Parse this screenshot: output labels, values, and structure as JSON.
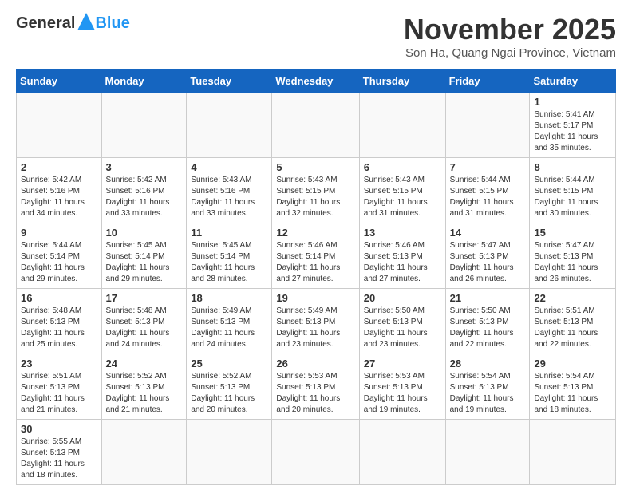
{
  "header": {
    "logo_general": "General",
    "logo_blue": "Blue",
    "month_title": "November 2025",
    "location": "Son Ha, Quang Ngai Province, Vietnam"
  },
  "weekdays": [
    "Sunday",
    "Monday",
    "Tuesday",
    "Wednesday",
    "Thursday",
    "Friday",
    "Saturday"
  ],
  "weeks": [
    [
      {
        "day": "",
        "info": ""
      },
      {
        "day": "",
        "info": ""
      },
      {
        "day": "",
        "info": ""
      },
      {
        "day": "",
        "info": ""
      },
      {
        "day": "",
        "info": ""
      },
      {
        "day": "",
        "info": ""
      },
      {
        "day": "1",
        "info": "Sunrise: 5:41 AM\nSunset: 5:17 PM\nDaylight: 11 hours and 35 minutes."
      }
    ],
    [
      {
        "day": "2",
        "info": "Sunrise: 5:42 AM\nSunset: 5:16 PM\nDaylight: 11 hours and 34 minutes."
      },
      {
        "day": "3",
        "info": "Sunrise: 5:42 AM\nSunset: 5:16 PM\nDaylight: 11 hours and 33 minutes."
      },
      {
        "day": "4",
        "info": "Sunrise: 5:43 AM\nSunset: 5:16 PM\nDaylight: 11 hours and 33 minutes."
      },
      {
        "day": "5",
        "info": "Sunrise: 5:43 AM\nSunset: 5:15 PM\nDaylight: 11 hours and 32 minutes."
      },
      {
        "day": "6",
        "info": "Sunrise: 5:43 AM\nSunset: 5:15 PM\nDaylight: 11 hours and 31 minutes."
      },
      {
        "day": "7",
        "info": "Sunrise: 5:44 AM\nSunset: 5:15 PM\nDaylight: 11 hours and 31 minutes."
      },
      {
        "day": "8",
        "info": "Sunrise: 5:44 AM\nSunset: 5:15 PM\nDaylight: 11 hours and 30 minutes."
      }
    ],
    [
      {
        "day": "9",
        "info": "Sunrise: 5:44 AM\nSunset: 5:14 PM\nDaylight: 11 hours and 29 minutes."
      },
      {
        "day": "10",
        "info": "Sunrise: 5:45 AM\nSunset: 5:14 PM\nDaylight: 11 hours and 29 minutes."
      },
      {
        "day": "11",
        "info": "Sunrise: 5:45 AM\nSunset: 5:14 PM\nDaylight: 11 hours and 28 minutes."
      },
      {
        "day": "12",
        "info": "Sunrise: 5:46 AM\nSunset: 5:14 PM\nDaylight: 11 hours and 27 minutes."
      },
      {
        "day": "13",
        "info": "Sunrise: 5:46 AM\nSunset: 5:13 PM\nDaylight: 11 hours and 27 minutes."
      },
      {
        "day": "14",
        "info": "Sunrise: 5:47 AM\nSunset: 5:13 PM\nDaylight: 11 hours and 26 minutes."
      },
      {
        "day": "15",
        "info": "Sunrise: 5:47 AM\nSunset: 5:13 PM\nDaylight: 11 hours and 26 minutes."
      }
    ],
    [
      {
        "day": "16",
        "info": "Sunrise: 5:48 AM\nSunset: 5:13 PM\nDaylight: 11 hours and 25 minutes."
      },
      {
        "day": "17",
        "info": "Sunrise: 5:48 AM\nSunset: 5:13 PM\nDaylight: 11 hours and 24 minutes."
      },
      {
        "day": "18",
        "info": "Sunrise: 5:49 AM\nSunset: 5:13 PM\nDaylight: 11 hours and 24 minutes."
      },
      {
        "day": "19",
        "info": "Sunrise: 5:49 AM\nSunset: 5:13 PM\nDaylight: 11 hours and 23 minutes."
      },
      {
        "day": "20",
        "info": "Sunrise: 5:50 AM\nSunset: 5:13 PM\nDaylight: 11 hours and 23 minutes."
      },
      {
        "day": "21",
        "info": "Sunrise: 5:50 AM\nSunset: 5:13 PM\nDaylight: 11 hours and 22 minutes."
      },
      {
        "day": "22",
        "info": "Sunrise: 5:51 AM\nSunset: 5:13 PM\nDaylight: 11 hours and 22 minutes."
      }
    ],
    [
      {
        "day": "23",
        "info": "Sunrise: 5:51 AM\nSunset: 5:13 PM\nDaylight: 11 hours and 21 minutes."
      },
      {
        "day": "24",
        "info": "Sunrise: 5:52 AM\nSunset: 5:13 PM\nDaylight: 11 hours and 21 minutes."
      },
      {
        "day": "25",
        "info": "Sunrise: 5:52 AM\nSunset: 5:13 PM\nDaylight: 11 hours and 20 minutes."
      },
      {
        "day": "26",
        "info": "Sunrise: 5:53 AM\nSunset: 5:13 PM\nDaylight: 11 hours and 20 minutes."
      },
      {
        "day": "27",
        "info": "Sunrise: 5:53 AM\nSunset: 5:13 PM\nDaylight: 11 hours and 19 minutes."
      },
      {
        "day": "28",
        "info": "Sunrise: 5:54 AM\nSunset: 5:13 PM\nDaylight: 11 hours and 19 minutes."
      },
      {
        "day": "29",
        "info": "Sunrise: 5:54 AM\nSunset: 5:13 PM\nDaylight: 11 hours and 18 minutes."
      }
    ],
    [
      {
        "day": "30",
        "info": "Sunrise: 5:55 AM\nSunset: 5:13 PM\nDaylight: 11 hours and 18 minutes."
      },
      {
        "day": "",
        "info": ""
      },
      {
        "day": "",
        "info": ""
      },
      {
        "day": "",
        "info": ""
      },
      {
        "day": "",
        "info": ""
      },
      {
        "day": "",
        "info": ""
      },
      {
        "day": "",
        "info": ""
      }
    ]
  ]
}
